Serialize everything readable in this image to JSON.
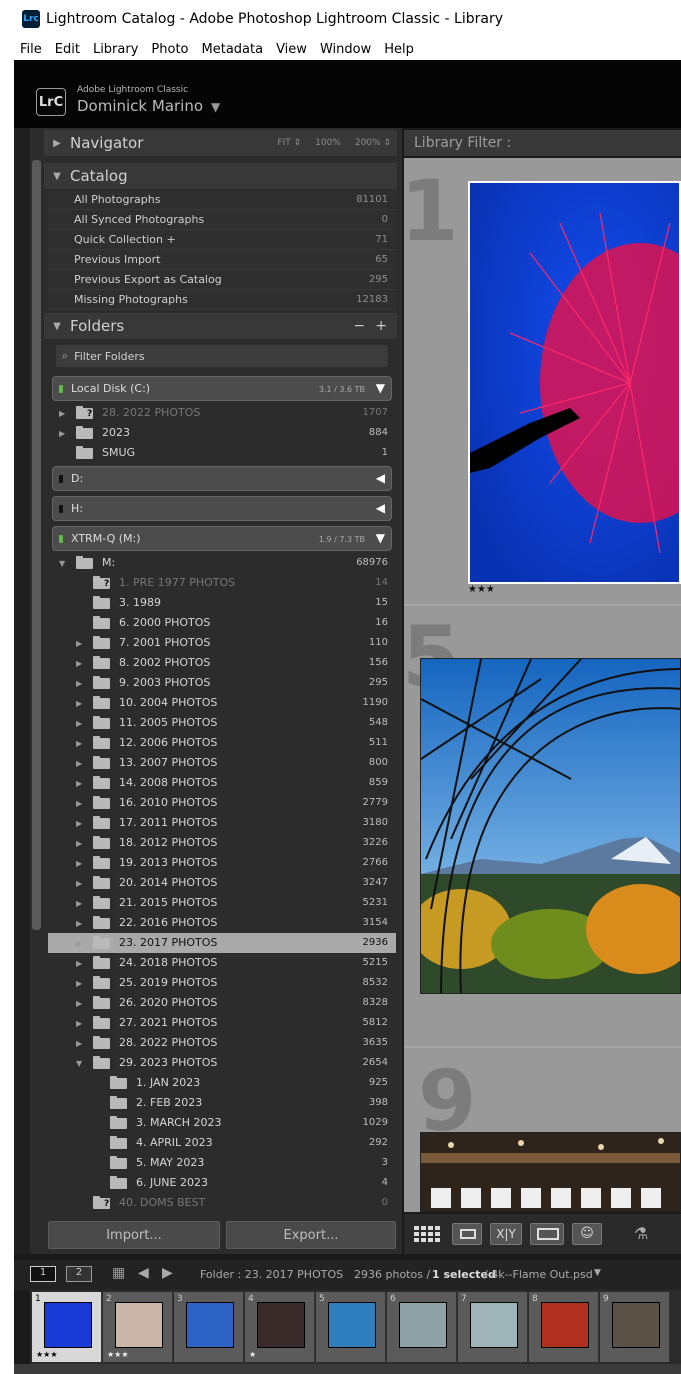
{
  "window": {
    "title": "Lightroom Catalog - Adobe Photoshop Lightroom Classic - Library",
    "icon_label": "Lrc"
  },
  "menu": [
    "File",
    "Edit",
    "Library",
    "Photo",
    "Metadata",
    "View",
    "Window",
    "Help"
  ],
  "identity": {
    "badge": "LrC",
    "app": "Adobe Lightroom Classic",
    "user": "Dominick Marino",
    "arrow": "▼"
  },
  "navigator": {
    "title": "Navigator",
    "options": [
      "FIT ⇕",
      "100%",
      "200% ⇕"
    ]
  },
  "catalog": {
    "title": "Catalog",
    "items": [
      {
        "label": "All Photographs",
        "count": "81101"
      },
      {
        "label": "All Synced Photographs",
        "count": "0"
      },
      {
        "label": "Quick Collection +",
        "count": "71"
      },
      {
        "label": "Previous Import",
        "count": "65"
      },
      {
        "label": "Previous Export as Catalog",
        "count": "295"
      },
      {
        "label": "Missing Photographs",
        "count": "12183"
      }
    ]
  },
  "folders": {
    "title": "Folders",
    "filter_placeholder": "Filter Folders",
    "volumes": [
      {
        "name": "Local Disk (C:)",
        "size": "3.1 / 3.6 TB"
      },
      {
        "name": "D:",
        "size": ""
      },
      {
        "name": "H:",
        "size": ""
      },
      {
        "name": "XTRM-Q (M:)",
        "size": "1.9 / 7.3 TB"
      }
    ],
    "c_rows": [
      {
        "name": "28. 2022 PHOTOS",
        "count": "1707"
      },
      {
        "name": "2023",
        "count": "884"
      },
      {
        "name": "SMUG",
        "count": "1"
      }
    ],
    "m_root": {
      "name": "M:",
      "count": "68976"
    },
    "m_rows": [
      {
        "name": "1. PRE 1977 PHOTOS",
        "count": "14"
      },
      {
        "name": "3. 1989",
        "count": "15"
      },
      {
        "name": "6. 2000 PHOTOS",
        "count": "16"
      },
      {
        "name": "7. 2001 PHOTOS",
        "count": "110"
      },
      {
        "name": "8. 2002 PHOTOS",
        "count": "156"
      },
      {
        "name": "9. 2003 PHOTOS",
        "count": "295"
      },
      {
        "name": "10. 2004 PHOTOS",
        "count": "1190"
      },
      {
        "name": "11. 2005 PHOTOS",
        "count": "548"
      },
      {
        "name": "12. 2006 PHOTOS",
        "count": "511"
      },
      {
        "name": "13. 2007 PHOTOS",
        "count": "800"
      },
      {
        "name": "14. 2008  PHOTOS",
        "count": "859"
      },
      {
        "name": "16. 2010 PHOTOS",
        "count": "2779"
      },
      {
        "name": "17. 2011 PHOTOS",
        "count": "3180"
      },
      {
        "name": "18. 2012 PHOTOS",
        "count": "3226"
      },
      {
        "name": "19. 2013 PHOTOS",
        "count": "2766"
      },
      {
        "name": "20. 2014 PHOTOS",
        "count": "3247"
      },
      {
        "name": "21. 2015 PHOTOS",
        "count": "5231"
      },
      {
        "name": "22. 2016 PHOTOS",
        "count": "3154"
      },
      {
        "name": "23. 2017 PHOTOS",
        "count": "2936"
      },
      {
        "name": "24. 2018 PHOTOS",
        "count": "5215"
      },
      {
        "name": "25. 2019 PHOTOS",
        "count": "8532"
      },
      {
        "name": "26. 2020 PHOTOS",
        "count": "8328"
      },
      {
        "name": "27. 2021 PHOTOS",
        "count": "5812"
      },
      {
        "name": "28. 2022 PHOTOS",
        "count": "3635"
      },
      {
        "name": "29. 2023 PHOTOS",
        "count": "2654"
      }
    ],
    "sub_rows": [
      {
        "name": "1. JAN 2023",
        "count": "925"
      },
      {
        "name": "2. FEB 2023",
        "count": "398"
      },
      {
        "name": "3. MARCH 2023",
        "count": "1029"
      },
      {
        "name": "4. APRIL 2023",
        "count": "292"
      },
      {
        "name": "5. MAY 2023",
        "count": "3"
      },
      {
        "name": "6. JUNE 2023",
        "count": "4"
      }
    ],
    "last_row": {
      "name": "40. DOMS BEST",
      "count": "0"
    }
  },
  "buttons": {
    "import": "Import...",
    "export": "Export..."
  },
  "library_filter": "Library Filter :",
  "grid": {
    "cells": [
      {
        "number": "1",
        "rating": "★★★"
      },
      {
        "number": "5",
        "rating": ""
      },
      {
        "number": "9",
        "rating": ""
      }
    ]
  },
  "filmstrip_bar": {
    "screen1": "1",
    "screen2": "2",
    "folder": "Folder : 23. 2017 PHOTOS",
    "count": "2936 photos /",
    "selected": "1 selected",
    "file": "/ 4k--Flame Out.psd",
    "arrow": "▼"
  },
  "thumbnails": [
    {
      "n": "1",
      "stars": "★★★"
    },
    {
      "n": "2",
      "stars": "★★★"
    },
    {
      "n": "3",
      "stars": ""
    },
    {
      "n": "4",
      "stars": "★"
    },
    {
      "n": "5",
      "stars": ""
    },
    {
      "n": "6",
      "stars": ""
    },
    {
      "n": "7",
      "stars": ""
    },
    {
      "n": "8",
      "stars": ""
    },
    {
      "n": "9",
      "stars": ""
    }
  ],
  "colors": {
    "selected_row": "#a9a9a9",
    "panel": "#2c2c2c",
    "grid": "#a6a6a6"
  }
}
